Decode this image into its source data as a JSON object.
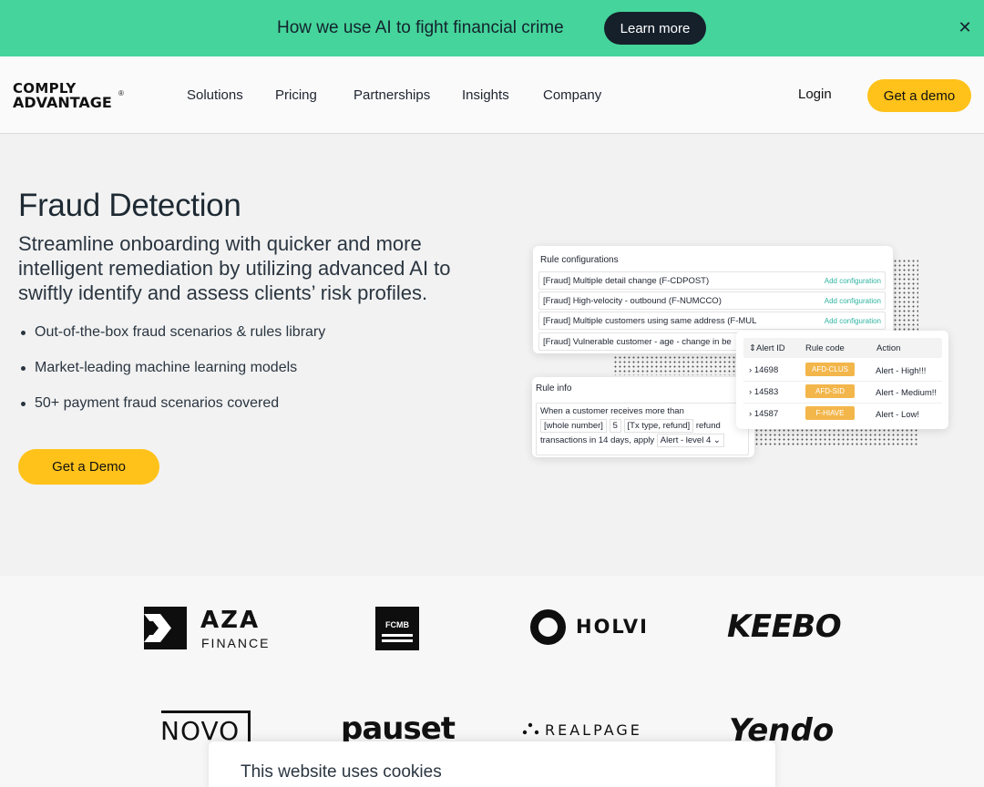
{
  "banner": {
    "text": "How we use AI to fight financial crime",
    "button": "Learn more",
    "close": "✕"
  },
  "nav": {
    "logo_line1": "COMPLY",
    "logo_line2": "ADVANTAGE",
    "logo_reg": "®",
    "items": [
      "Solutions",
      "Pricing",
      "Partnerships",
      "Insights",
      "Company"
    ],
    "login": "Login",
    "demo": "Get a demo"
  },
  "hero": {
    "title": "Fraud Detection",
    "subtitle": "Streamline onboarding with quicker and more intelligent remediation by utilizing advanced AI to swiftly identify and assess clients’ risk profiles.",
    "bullets": [
      "Out-of-the-box fraud scenarios & rules library",
      "Market-leading machine learning models",
      "50+ payment fraud scenarios covered"
    ],
    "cta": "Get a Demo"
  },
  "rule_config": {
    "title": "Rule configurations",
    "rows": [
      {
        "text": "[Fraud] Multiple detail change (F-CDPOST)",
        "action": "Add configuration"
      },
      {
        "text": "[Fraud] High-velocity - outbound (F-NUMCCO)",
        "action": "Add configuration"
      },
      {
        "text": "[Fraud] Multiple customers using same address (F-MUL",
        "action": "Add configuration"
      },
      {
        "text": "[Fraud] Vulnerable customer - age - change in be",
        "action": ""
      }
    ]
  },
  "rule_info": {
    "title": "Rule info",
    "line1": "When a customer receives more than",
    "chip_number": "[whole number]",
    "chip_value": "5",
    "chip_type": "[Tx type, refund]",
    "refund": "refund",
    "line3": "transactions in 14 days, apply",
    "chip_alert": "Alert - level 4 ⌄"
  },
  "alerts": {
    "headers": [
      "Alert ID",
      "Rule code",
      "Action"
    ],
    "sort_glyph": "⇕",
    "rows": [
      {
        "id": "14698",
        "code": "AFD-CLUS",
        "action": "Alert - High!!!"
      },
      {
        "id": "14583",
        "code": "AFD-SID",
        "action": "Alert - Medium!!"
      },
      {
        "id": "14587",
        "code": "F-HIAVE",
        "action": "Alert - Low!"
      }
    ]
  },
  "logos": {
    "aza": "AZA",
    "aza_sub": "FINANCE",
    "fcmb": "FCMB",
    "holvi": "HOLVI",
    "keebo": "KEEBO",
    "novo": "NOVO",
    "pauset": "pauset",
    "realpage": "REALPAGE",
    "yendo": "Yendo"
  },
  "cookie": {
    "text": "This website uses cookies"
  }
}
